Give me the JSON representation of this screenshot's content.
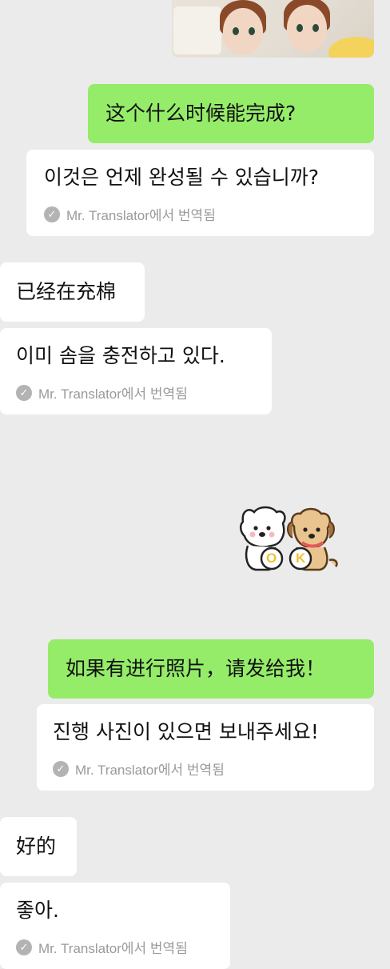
{
  "messages": [
    {
      "id": "m1",
      "side": "right",
      "text": "这个什么时候能完成?"
    },
    {
      "id": "m1t",
      "side": "right",
      "text": "이것은 언제 완성될 수 있습니까?",
      "note": "Mr. Translator에서 번역됨"
    },
    {
      "id": "m2",
      "side": "left",
      "text": "已经在充棉"
    },
    {
      "id": "m2t",
      "side": "left",
      "text": "이미 솜을 충전하고 있다.",
      "note": "Mr. Translator에서 번역됨"
    },
    {
      "id": "m3",
      "side": "right",
      "text": "如果有进行照片，请发给我！"
    },
    {
      "id": "m3t",
      "side": "right",
      "text": "진행 사진이 있으면 보내주세요!",
      "note": "Mr. Translator에서 번역됨"
    },
    {
      "id": "m4",
      "side": "left",
      "text": "好的"
    },
    {
      "id": "m4t",
      "side": "left",
      "text": "좋아.",
      "note": "Mr. Translator에서 번역됨"
    }
  ],
  "sticker": {
    "text": "OK",
    "icon": "two-dogs-ok-sticker"
  },
  "colors": {
    "background": "#ebebeb",
    "sent_bubble": "#95ec69",
    "received_bubble": "#ffffff",
    "note_text": "#9a9a9a"
  }
}
